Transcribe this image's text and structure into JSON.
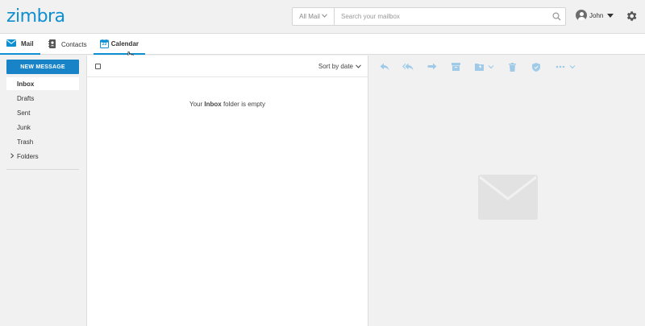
{
  "app": {
    "logo": "zimbra"
  },
  "search": {
    "scope_label": "All Mail",
    "placeholder": "Search your mailbox"
  },
  "user": {
    "name": "John"
  },
  "tabs": [
    {
      "label": "Mail",
      "icon": "envelope-icon"
    },
    {
      "label": "Contacts",
      "icon": "contacts-book-icon"
    },
    {
      "label": "Calendar",
      "icon": "calendar-icon",
      "icon_text": "23"
    }
  ],
  "sidebar": {
    "new_message_label": "NEW MESSAGE",
    "folders": [
      {
        "label": "Inbox"
      },
      {
        "label": "Drafts"
      },
      {
        "label": "Sent"
      },
      {
        "label": "Junk"
      },
      {
        "label": "Trash"
      },
      {
        "label": "Folders"
      }
    ]
  },
  "message_list": {
    "sort_label": "Sort by date",
    "empty_prefix": "Your ",
    "empty_folder": "Inbox",
    "empty_suffix": " folder is empty"
  },
  "toolbar": {
    "icons": [
      "reply-icon",
      "reply-all-icon",
      "forward-icon",
      "archive-icon",
      "move-to-folder-icon",
      "delete-icon",
      "spam-shield-icon",
      "more-actions-icon"
    ]
  },
  "colors": {
    "brand": "#0e8fd2",
    "button": "#1883c6",
    "toolbar_icon": "#9fcbe8",
    "empty_envelope": "#e2e2e2"
  }
}
